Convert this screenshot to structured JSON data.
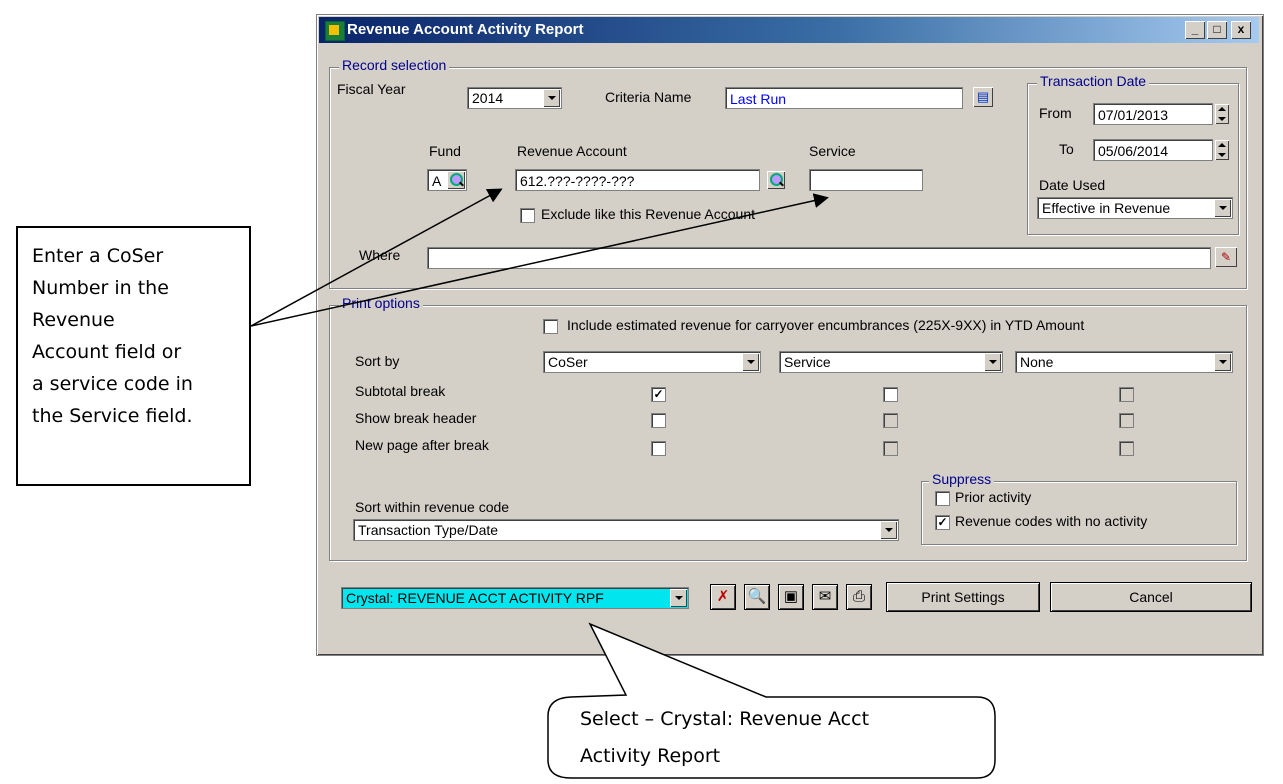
{
  "window": {
    "title": "Revenue Account Activity Report",
    "controls": [
      "_",
      "□",
      "x"
    ]
  },
  "record_selection": {
    "group_label": "Record selection",
    "fiscal_year_label": "Fiscal Year",
    "fiscal_year_value": "2014",
    "criteria_name_label": "Criteria Name",
    "criteria_name_value": "Last Run",
    "fund_label": "Fund",
    "fund_value": "A",
    "revenue_account_label": "Revenue Account",
    "revenue_account_value": "612.???-????-???",
    "service_label": "Service",
    "service_value": "",
    "exclude_label": "Exclude like this Revenue Account",
    "where_label": "Where",
    "where_value": ""
  },
  "transaction_date": {
    "group_label": "Transaction Date",
    "from_label": "From",
    "from_value": "07/01/2013",
    "to_label": "To",
    "to_value": "05/06/2014",
    "date_used_label": "Date Used",
    "date_used_value": "Effective in Revenue"
  },
  "print_options": {
    "group_label": "Print options",
    "include_estimated_label": "Include estimated revenue for carryover encumbrances (225X-9XX) in YTD Amount",
    "sort_by_label": "Sort by",
    "sort1": "CoSer",
    "sort2": "Service",
    "sort3": "None",
    "subtotal_break_label": "Subtotal break",
    "show_break_header_label": "Show break header",
    "new_page_after_break_label": "New page after break",
    "sort_within_label": "Sort within revenue code",
    "sort_within_value": "Transaction Type/Date",
    "suppress_label": "Suppress",
    "prior_activity_label": "Prior activity",
    "no_activity_label": "Revenue codes with no activity",
    "check_mark": "✓"
  },
  "footer": {
    "report_select_value": "Crystal: REVENUE ACCT ACTIVITY RPF",
    "print_settings_label": "Print Settings",
    "cancel_label": "Cancel"
  },
  "annotations": {
    "left_callout": [
      "Enter a CoSer",
      "Number in the",
      "Revenue",
      "Account field or",
      "a service code in",
      "the Service field."
    ],
    "bottom_callout": [
      "Select – Crystal: Revenue Acct",
      "Activity Report"
    ]
  },
  "colors": {
    "titlebar_start": "#0a246a",
    "titlebar_end": "#a6caf0",
    "dialog_face": "#d4d0c8",
    "group_label": "#00008b",
    "report_select_highlight": "#00e5ee",
    "criteria_text": "#0000ff"
  }
}
